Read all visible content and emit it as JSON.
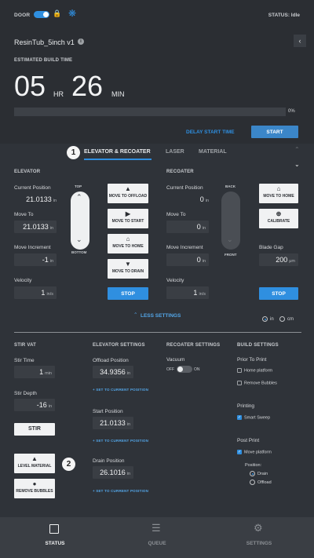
{
  "top": {
    "door_label": "DOOR",
    "status": "STATUS: Idle",
    "file_name": "ResinTub_5inch v1",
    "est_label": "ESTIMATED BUILD TIME",
    "hours": "05",
    "hr_unit": "HR",
    "minutes": "26",
    "min_unit": "MIN",
    "progress": 0,
    "progress_label": "0%",
    "delay_label": "DELAY START TIME",
    "start_label": "START"
  },
  "tabs": {
    "items": [
      "ELEVATOR & RECOATER",
      "LASER",
      "MATERIAL"
    ],
    "active": 0
  },
  "callouts": [
    "1",
    "2"
  ],
  "elevator": {
    "title": "ELEVATOR",
    "current_label": "Current Position",
    "current_value": "21.0133",
    "current_unit": "in",
    "move_to_label": "Move To",
    "move_to_value": "21.0133",
    "move_to_unit": "in",
    "inc_label": "Move Increment",
    "inc_value": "-1",
    "inc_unit": "in",
    "vel_label": "Velocity",
    "vel_value": "1",
    "vel_unit": "in/s",
    "top": "TOP",
    "bottom": "BOTTOM",
    "buttons": [
      "MOVE TO OFFLOAD",
      "MOVE TO START",
      "MOVE TO HOME",
      "MOVE TO DRAIN"
    ],
    "stop": "STOP"
  },
  "recoater": {
    "title": "RECOATER",
    "current_label": "Current Position",
    "current_value": "0",
    "current_unit": "in",
    "move_to_label": "Move To",
    "move_to_value": "0",
    "move_to_unit": "in",
    "inc_label": "Move Increment",
    "inc_value": "0",
    "inc_unit": "in",
    "vel_label": "Velocity",
    "vel_value": "1",
    "vel_unit": "in/s",
    "back": "BACK",
    "front": "FRONT",
    "home": "MOVE TO HOME",
    "calibrate": "CALIBRATE",
    "gap_label": "Blade Gap",
    "gap_value": "200",
    "gap_unit": "μm",
    "stop": "STOP"
  },
  "less_settings": "LESS SETTINGS",
  "units": {
    "in": "in",
    "cm": "cm"
  },
  "stir": {
    "title": "STIR VAT",
    "time_label": "Stir Time",
    "time_value": "1",
    "time_unit": "min",
    "depth_label": "Stir Depth",
    "depth_value": "-16",
    "depth_unit": "in",
    "stir_btn": "STIR",
    "level_btn": "LEVEL MATERIAL",
    "remove_btn": "REMOVE BUBBLES"
  },
  "elev_settings": {
    "title": "ELEVATOR SETTINGS",
    "offload_label": "Offload Position",
    "offload_value": "34.9356",
    "start_label": "Start Position",
    "start_value": "21.0133",
    "drain_label": "Drain Position",
    "drain_value": "26.1016",
    "unit": "in",
    "set_current": "SET TO CURRENT POSITION"
  },
  "recoater_settings": {
    "title": "RECOATER SETTINGS",
    "vacuum": "Vacuum",
    "off": "OFF",
    "on": "ON"
  },
  "build": {
    "title": "BUILD SETTINGS",
    "prior": "Prior To Print",
    "home": "Home platform",
    "remove": "Remove Bubbles",
    "printing": "Printing",
    "smart": "Smart Sweep",
    "post": "Post Print",
    "move": "Move platform",
    "position": "Position:",
    "drain": "Drain",
    "offload": "Offload"
  },
  "nav": [
    {
      "label": "STATUS"
    },
    {
      "label": "QUEUE"
    },
    {
      "label": "SETTINGS"
    }
  ]
}
